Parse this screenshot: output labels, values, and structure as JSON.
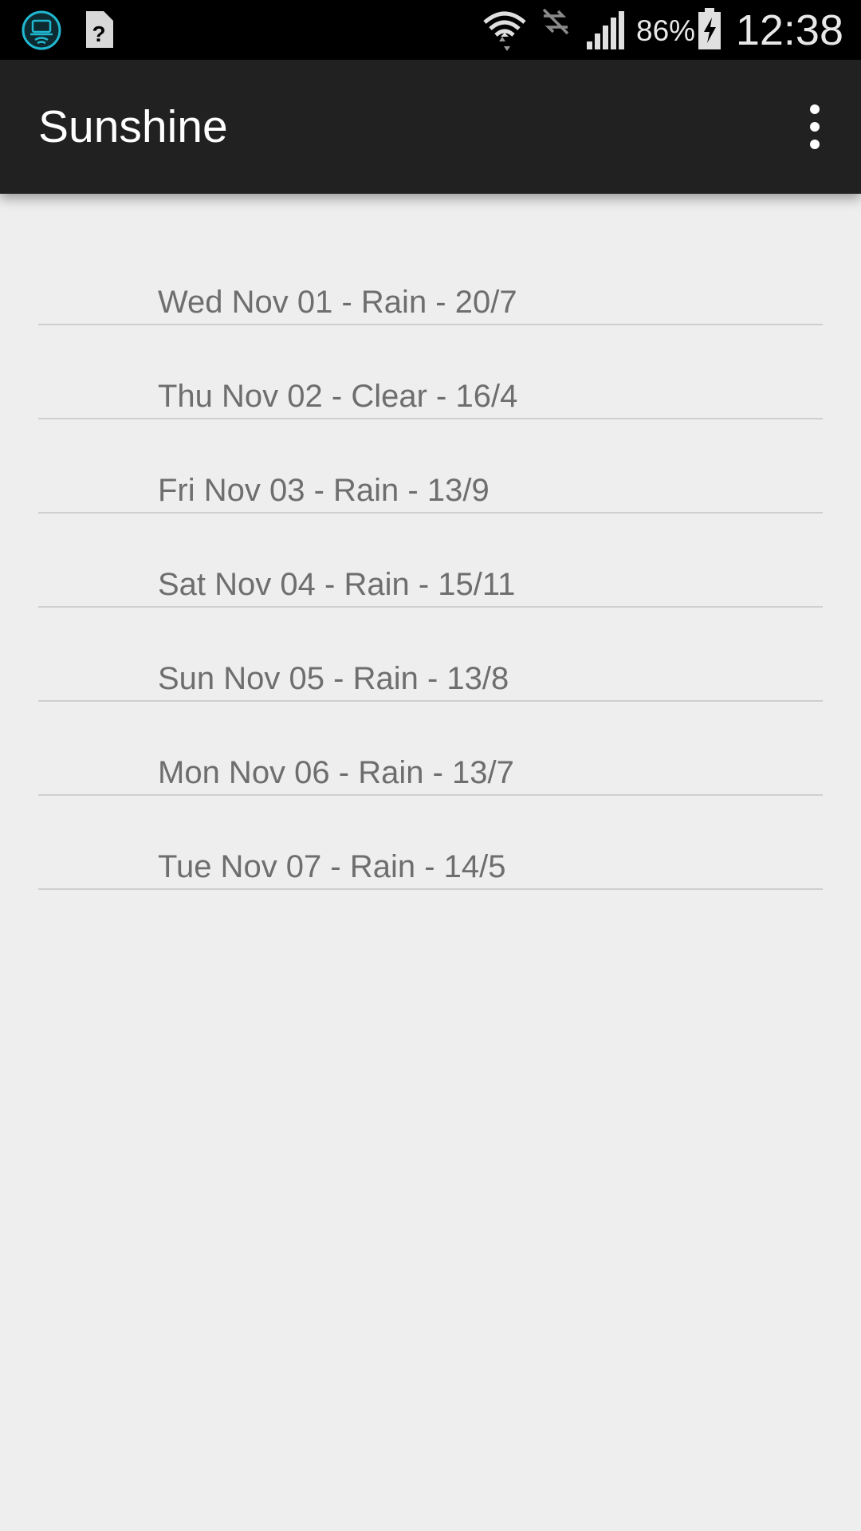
{
  "status_bar": {
    "icons": {
      "left": [
        "wifi-hotspot-app-icon",
        "unknown-file-icon"
      ],
      "right": [
        "wifi-icon",
        "no-data-icon",
        "signal-icon",
        "battery-charging-icon"
      ]
    },
    "battery_percent": "86%",
    "time": "12:38"
  },
  "action_bar": {
    "title": "Sunshine",
    "overflow_icon": "more-vert-icon"
  },
  "forecast": [
    {
      "text": "Wed Nov 01 - Rain - 20/7"
    },
    {
      "text": "Thu Nov 02 - Clear - 16/4"
    },
    {
      "text": "Fri Nov 03 - Rain - 13/9"
    },
    {
      "text": "Sat Nov 04 - Rain - 15/11"
    },
    {
      "text": "Sun Nov 05 - Rain - 13/8"
    },
    {
      "text": "Mon Nov 06 - Rain - 13/7"
    },
    {
      "text": "Tue Nov 07 - Rain - 14/5"
    }
  ],
  "colors": {
    "status_bar": "#000000",
    "action_bar": "#212121",
    "background": "#eeeeee",
    "list_text": "#6e6e6e",
    "divider": "#cfcfcf",
    "hotspot_icon_accent": "#20b8d0"
  }
}
